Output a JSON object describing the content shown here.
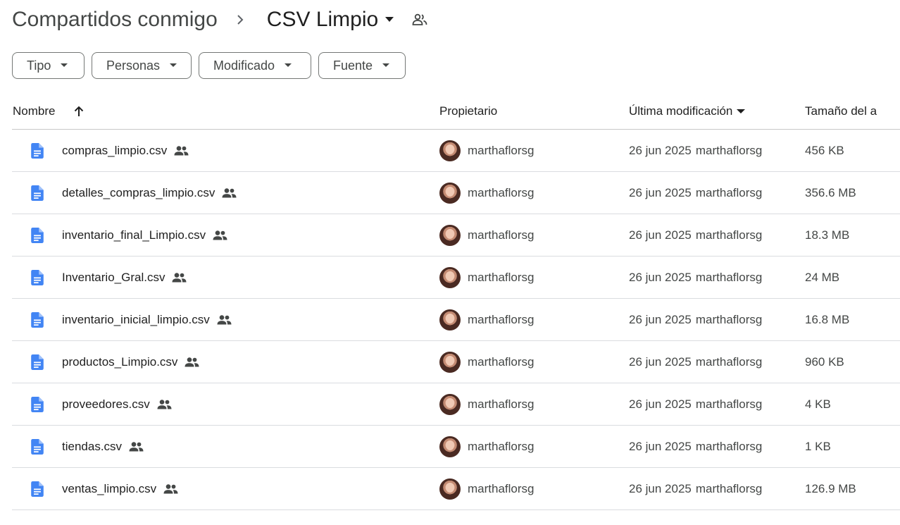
{
  "breadcrumb": {
    "root": "Compartidos conmigo",
    "current": "CSV Limpio"
  },
  "filters": [
    {
      "label": "Tipo"
    },
    {
      "label": "Personas"
    },
    {
      "label": "Modificado"
    },
    {
      "label": "Fuente"
    }
  ],
  "columns": {
    "name": "Nombre",
    "owner": "Propietario",
    "modified": "Última modificación",
    "size": "Tamaño del archivo"
  },
  "files": [
    {
      "name": "compras_limpio.csv",
      "owner": "marthaflorsg",
      "date": "26 jun 2025",
      "modified_by": "marthaflorsg",
      "size": "456 KB"
    },
    {
      "name": "detalles_compras_limpio.csv",
      "owner": "marthaflorsg",
      "date": "26 jun 2025",
      "modified_by": "marthaflorsg",
      "size": "356.6 MB"
    },
    {
      "name": "inventario_final_Limpio.csv",
      "owner": "marthaflorsg",
      "date": "26 jun 2025",
      "modified_by": "marthaflorsg",
      "size": "18.3 MB"
    },
    {
      "name": "Inventario_Gral.csv",
      "owner": "marthaflorsg",
      "date": "26 jun 2025",
      "modified_by": "marthaflorsg",
      "size": "24 MB"
    },
    {
      "name": "inventario_inicial_limpio.csv",
      "owner": "marthaflorsg",
      "date": "26 jun 2025",
      "modified_by": "marthaflorsg",
      "size": "16.8 MB"
    },
    {
      "name": "productos_Limpio.csv",
      "owner": "marthaflorsg",
      "date": "26 jun 2025",
      "modified_by": "marthaflorsg",
      "size": "960 KB"
    },
    {
      "name": "proveedores.csv",
      "owner": "marthaflorsg",
      "date": "26 jun 2025",
      "modified_by": "marthaflorsg",
      "size": "4 KB"
    },
    {
      "name": "tiendas.csv",
      "owner": "marthaflorsg",
      "date": "26 jun 2025",
      "modified_by": "marthaflorsg",
      "size": "1 KB"
    },
    {
      "name": "ventas_limpio.csv",
      "owner": "marthaflorsg",
      "date": "26 jun 2025",
      "modified_by": "marthaflorsg",
      "size": "126.9 MB"
    }
  ],
  "icons": {
    "file": "doc-file-icon",
    "shared": "shared-people-icon",
    "sort": "arrow-up-icon"
  },
  "colors": {
    "file_icon": "#4285f4",
    "divider": "#dadce0"
  }
}
